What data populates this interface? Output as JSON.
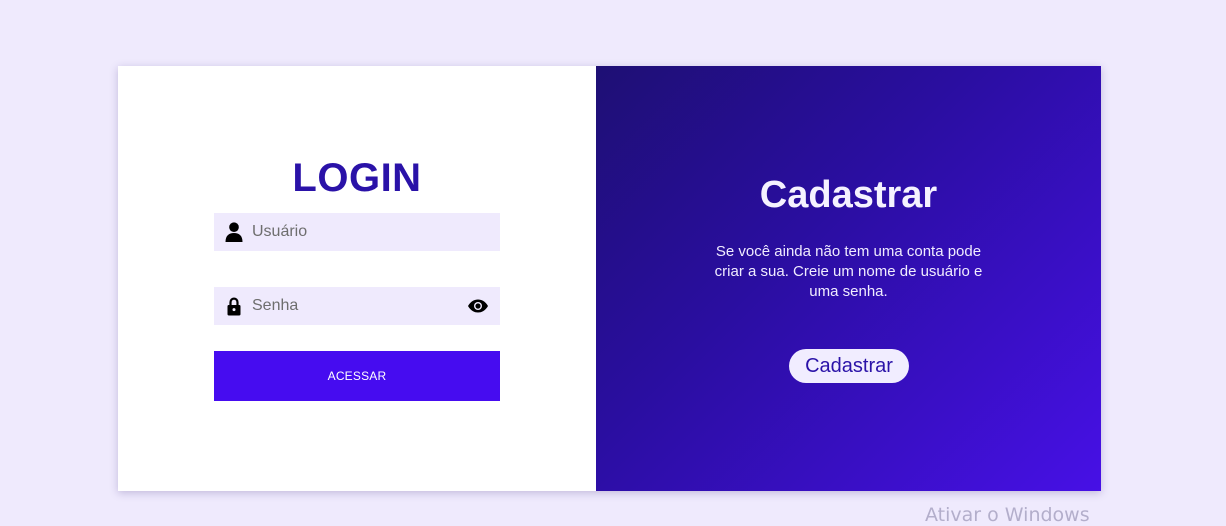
{
  "login": {
    "title": "LOGIN",
    "username_placeholder": "Usuário",
    "password_placeholder": "Senha",
    "submit_label": "ACESSAR",
    "icons": {
      "user": "user-icon",
      "lock": "lock-icon",
      "eye": "eye-icon"
    }
  },
  "register": {
    "title": "Cadastrar",
    "description": "Se você ainda não tem uma conta pode criar a sua. Creie um nome de usuário e uma senha.",
    "button_label": "Cadastrar"
  },
  "os_watermark": "Ativar o Windows",
  "colors": {
    "page_background": "#efeafd",
    "accent": "#460cf0",
    "title_color": "#2a12a8",
    "gradient_start": "#1e0f74",
    "gradient_end": "#4710e6"
  }
}
